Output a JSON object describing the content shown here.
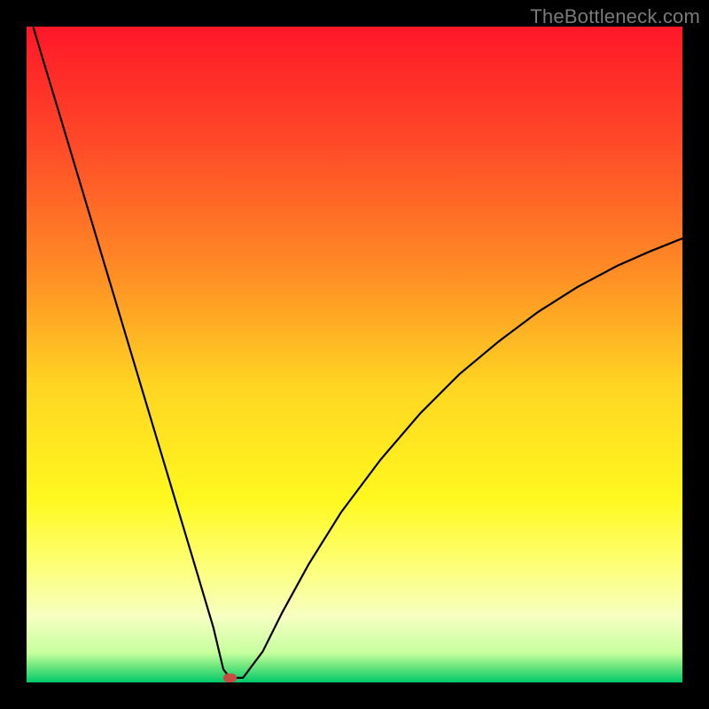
{
  "watermark": "TheBottleneck.com",
  "chart_data": {
    "type": "line",
    "title": "",
    "xlabel": "",
    "ylabel": "",
    "xlim": [
      0,
      100
    ],
    "ylim": [
      0,
      100
    ],
    "grid": false,
    "legend": false,
    "coloring": "vertical-gradient",
    "gradient_stops": [
      {
        "offset": 0.0,
        "color": "#ff1728"
      },
      {
        "offset": 0.18,
        "color": "#ff4a28"
      },
      {
        "offset": 0.38,
        "color": "#ff8f25"
      },
      {
        "offset": 0.55,
        "color": "#ffd622"
      },
      {
        "offset": 0.72,
        "color": "#fff81f"
      },
      {
        "offset": 0.82,
        "color": "#fdff75"
      },
      {
        "offset": 0.9,
        "color": "#f6ffc1"
      },
      {
        "offset": 0.955,
        "color": "#c6ff9e"
      },
      {
        "offset": 0.975,
        "color": "#6fe77e"
      },
      {
        "offset": 1.0,
        "color": "#00c96b"
      }
    ],
    "series": [
      {
        "name": "bottleneck-curve",
        "stroke": "#000000",
        "x": [
          1.0,
          3.0,
          5.0,
          8.0,
          11.0,
          14.0,
          17.0,
          20.0,
          23.0,
          26.0,
          28.5,
          30.0,
          31.0,
          33.0,
          36.0,
          39.0,
          43.0,
          48.0,
          54.0,
          60.0,
          66.0,
          72.0,
          78.0,
          84.0,
          90.0,
          95.0,
          100.0
        ],
        "y": [
          100.0,
          93.3,
          86.7,
          76.7,
          66.7,
          56.7,
          46.7,
          36.7,
          26.7,
          16.7,
          8.3,
          2.0,
          0.7,
          0.7,
          4.7,
          10.7,
          18.0,
          26.0,
          34.0,
          41.0,
          47.0,
          52.0,
          56.5,
          60.3,
          63.5,
          65.7,
          67.7
        ]
      }
    ],
    "marker": {
      "x": 31.0,
      "y": 0.7,
      "color": "#c94a40"
    }
  }
}
